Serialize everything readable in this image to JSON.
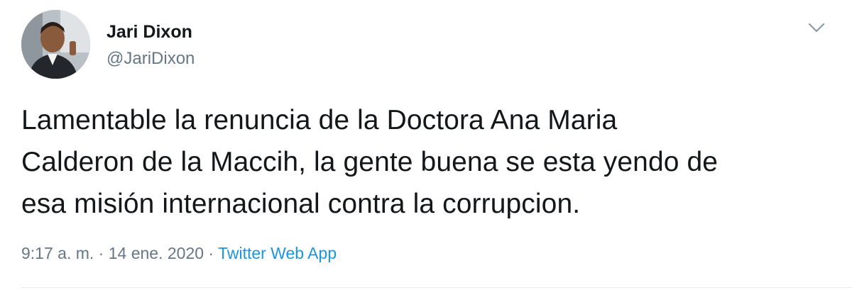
{
  "tweet": {
    "author": {
      "display_name": "Jari Dixon",
      "handle": "@JariDixon",
      "avatar_icon": "profile-photo"
    },
    "menu_icon": "chevron-down-icon",
    "text_lines": [
      "Lamentable la renuncia de la Doctora Ana Maria",
      "Calderon de la Maccih, la gente buena se esta yendo de",
      "esa misión internacional contra la corrupcion."
    ],
    "meta": {
      "time": "9:17 a. m.",
      "separator1": " · ",
      "date": "14 ene. 2020",
      "separator2": " · ",
      "source": "Twitter Web App"
    }
  },
  "colors": {
    "text": "#14171a",
    "secondary": "#657786",
    "link": "#1b95e0",
    "divider": "#e6ecf0"
  }
}
